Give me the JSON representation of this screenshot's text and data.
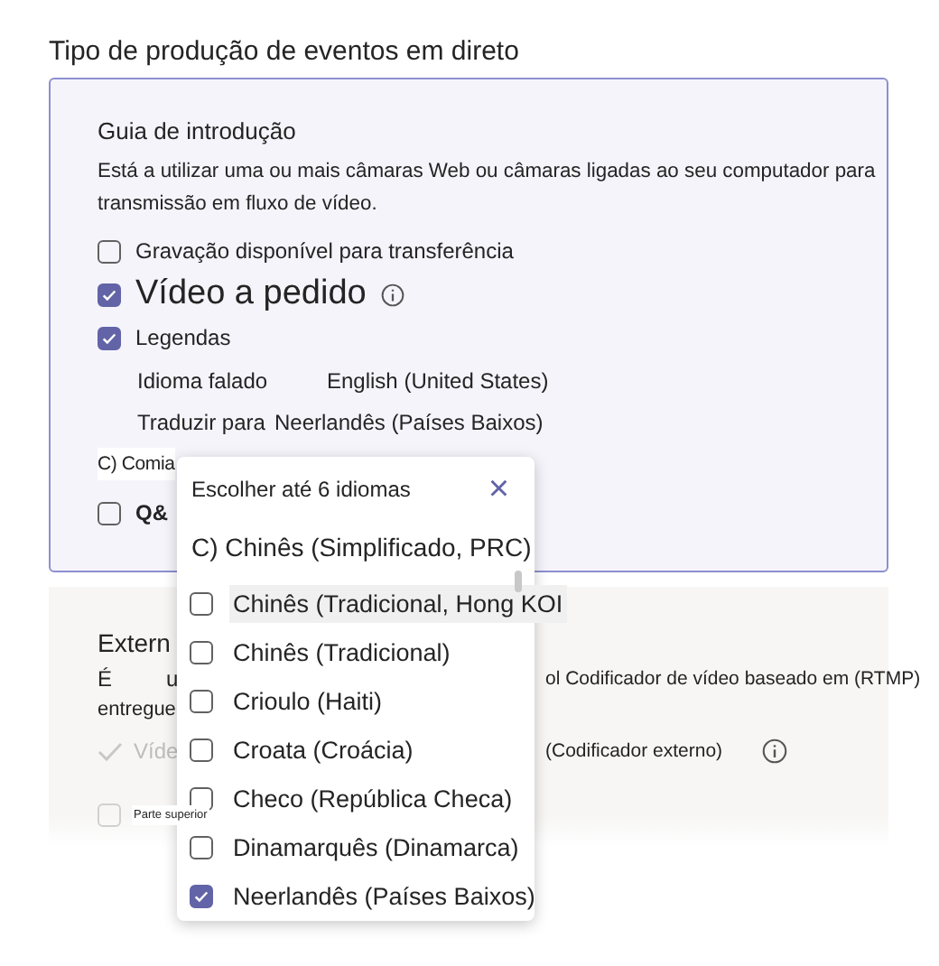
{
  "title": "Tipo de produção de eventos em direto",
  "live_card": {
    "heading": "Guia de introdução",
    "description": "Está a utilizar uma ou mais câmaras Web ou câmaras ligadas ao seu computador para transmissão em fluxo de vídeo.",
    "options": [
      {
        "kind": "checkbox",
        "label": "Gravação disponível para transferência",
        "checked": false
      },
      {
        "kind": "checkbox-large",
        "label": "Vídeo a pedido",
        "checked": true
      },
      {
        "kind": "checkbox",
        "label": "Legendas",
        "checked": true
      }
    ],
    "caption_settings": [
      {
        "label": "Idioma falado",
        "value": "English (United States)"
      },
      {
        "label": "Traduzir para",
        "value": "Neerlandês (Países Baixos)"
      }
    ],
    "comments_label": "C) Comia",
    "qa": {
      "label": "Q&",
      "checked": false
    }
  },
  "external_card": {
    "heading": "Extern",
    "line_1_start": "É",
    "line_1_mid": "u",
    "line_1_end": "ol Codificador de vídeo baseado em (RTMP)",
    "line_2": "entregue",
    "video_option": {
      "label": "Víde",
      "note": "(Codificador externo)",
      "disabled": true
    },
    "top_option": {
      "label": "Parte superior",
      "checked": false
    }
  },
  "language_popup": {
    "title": "Escolher até 6 idiomas",
    "close": "×",
    "current": "C) Chinês (Simplificado, PRC)",
    "languages": [
      {
        "label": "Chinês (Tradicional, Hong KOI",
        "checked": false,
        "highlighted": true
      },
      {
        "label": "Chinês (Tradicional)",
        "checked": false,
        "highlighted": false
      },
      {
        "label": "Crioulo (Haiti)",
        "checked": false,
        "highlighted": false
      },
      {
        "label": "Croata (Croácia)",
        "checked": false,
        "highlighted": false
      },
      {
        "label": "Checo (República Checa)",
        "checked": false,
        "highlighted": false
      },
      {
        "label": "Dinamarquês (Dinamarca)",
        "checked": false,
        "highlighted": false
      },
      {
        "label": "Neerlandês (Países Baixos)",
        "checked": true,
        "highlighted": false
      }
    ]
  }
}
